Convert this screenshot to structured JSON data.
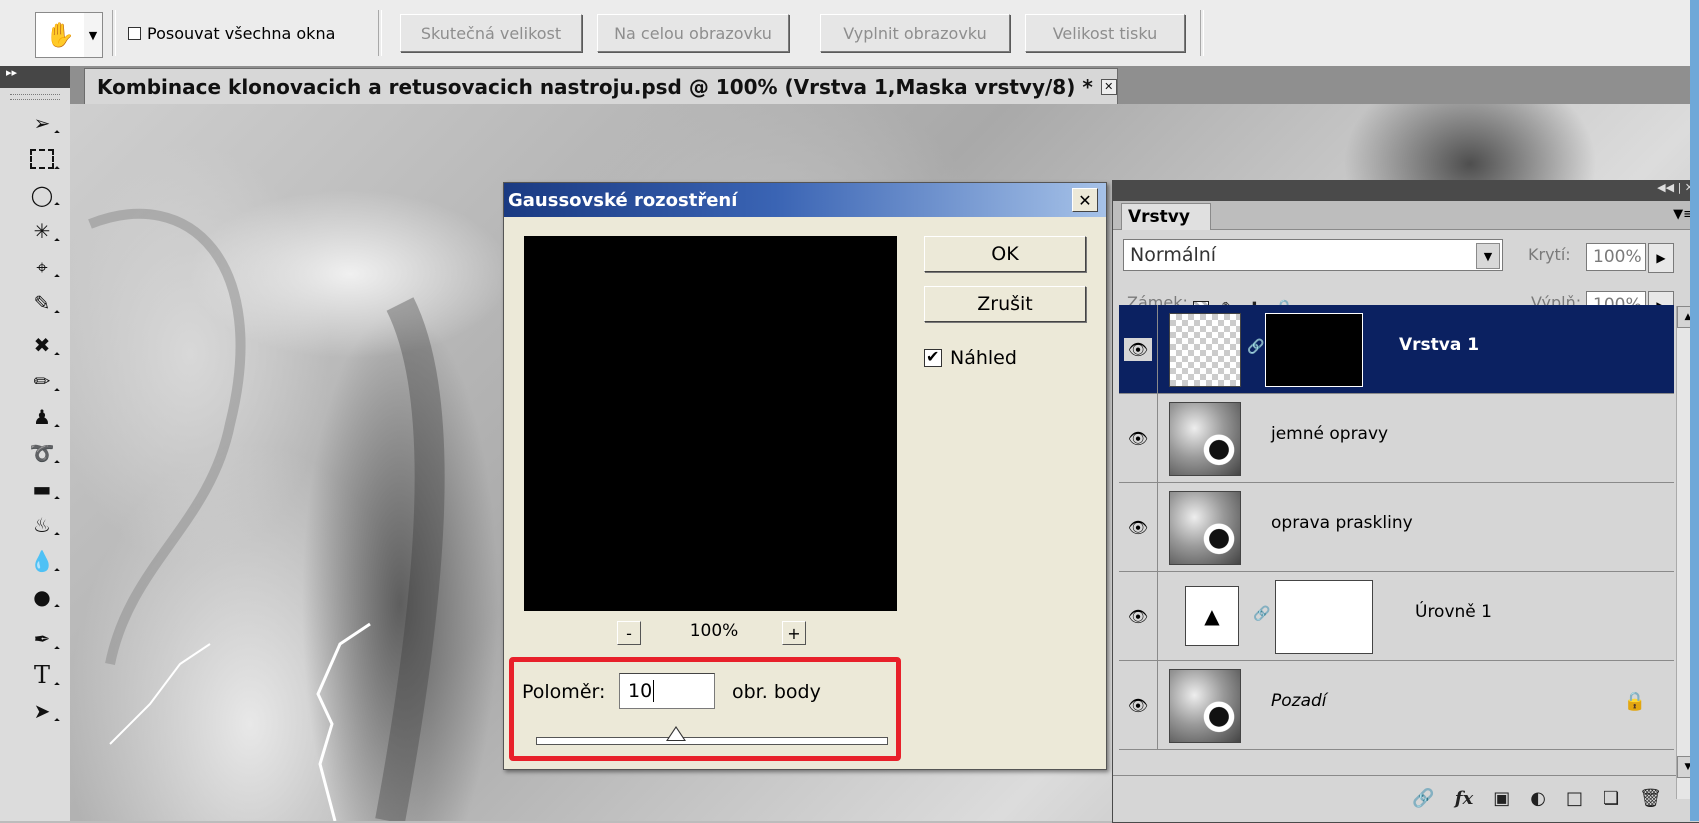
{
  "options_bar": {
    "hand_icon": "hand-icon",
    "scroll_all_label": "Posouvat všechna okna",
    "scroll_all_checked": false,
    "buttons": [
      "Skutečná velikost",
      "Na celou obrazovku",
      "Vyplnit obrazovku",
      "Velikost tisku"
    ]
  },
  "document": {
    "tab_title": "Kombinace klonovacich a retusovacich nastroju.psd @ 100% (Vrstva 1,Maska vrstvy/8) *"
  },
  "toolbox": {
    "tools": [
      "move-tool",
      "marquee-tool",
      "lasso-tool",
      "magic-wand-tool",
      "crop-tool",
      "eyedropper-tool",
      "healing-tool",
      "brush-tool",
      "clone-stamp-tool",
      "history-brush-tool",
      "eraser-tool",
      "paint-bucket-tool",
      "blur-tool",
      "dodge-tool",
      "pen-tool",
      "type-tool",
      "path-selection-tool"
    ],
    "type_glyph": "T"
  },
  "dialog": {
    "title": "Gaussovské rozostření",
    "ok_label": "OK",
    "cancel_label": "Zrušit",
    "preview_label": "Náhled",
    "preview_checked": true,
    "zoom_minus": "-",
    "zoom_plus": "+",
    "zoom_value": "100%",
    "radius_label": "Poloměr:",
    "radius_value": "10",
    "radius_unit": "obr. body",
    "highlight_color": "#e8202a"
  },
  "layers_panel": {
    "tab_label": "Vrstvy",
    "blend_mode": "Normální",
    "opacity_label": "Krytí:",
    "opacity_value": "100%",
    "lock_label": "Zámek:",
    "fill_label": "Výplň:",
    "fill_value": "100%",
    "layers": [
      {
        "name": "Vrstva 1",
        "selected": true
      },
      {
        "name": "jemné opravy",
        "selected": false
      },
      {
        "name": "oprava praskliny",
        "selected": false
      },
      {
        "name": "Úrovně 1",
        "selected": false
      },
      {
        "name": "Pozadí",
        "selected": false
      }
    ],
    "footer_icons": [
      "link-icon",
      "fx-icon",
      "mask-icon",
      "adjustment-icon",
      "folder-icon",
      "new-layer-icon",
      "trash-icon"
    ],
    "selection_color": "#0b2161"
  }
}
